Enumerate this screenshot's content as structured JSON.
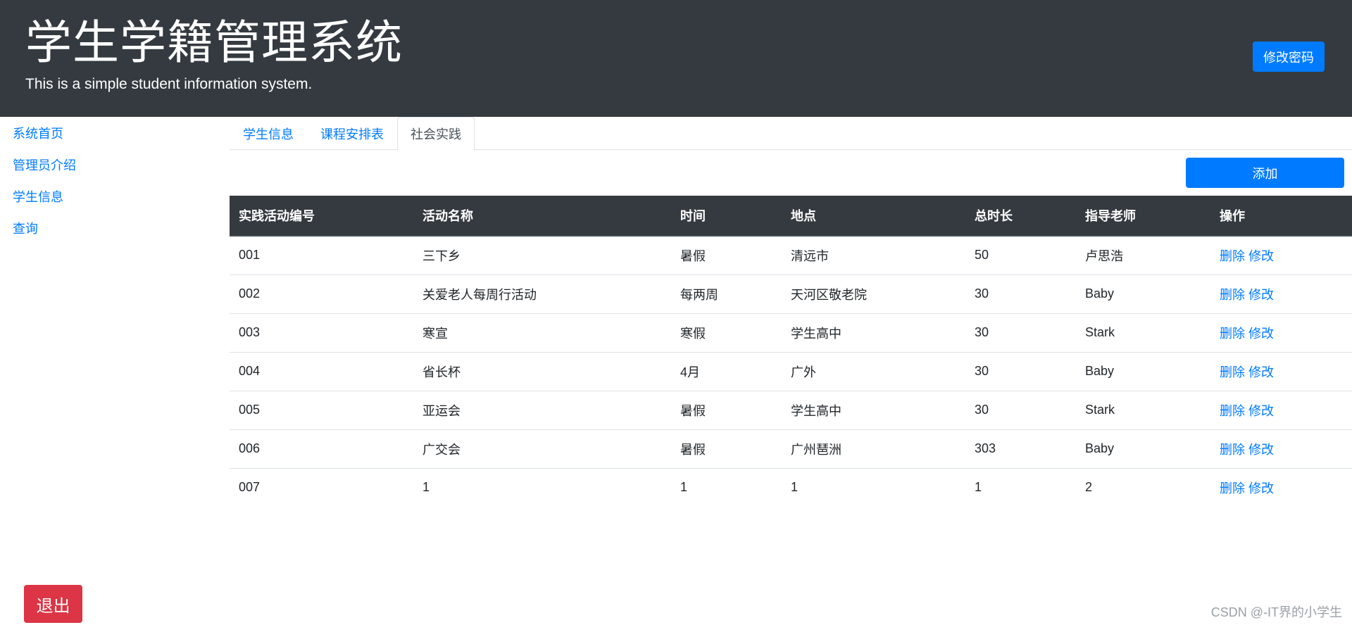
{
  "header": {
    "title": "学生学籍管理系统",
    "subtitle": "This is a simple student information system.",
    "change_password_label": "修改密码"
  },
  "sidebar": {
    "items": [
      {
        "label": "系统首页"
      },
      {
        "label": "管理员介绍"
      },
      {
        "label": "学生信息"
      },
      {
        "label": "查询"
      }
    ]
  },
  "tabs": [
    {
      "label": "学生信息",
      "active": false
    },
    {
      "label": "课程安排表",
      "active": false
    },
    {
      "label": "社会实践",
      "active": true
    }
  ],
  "toolbar": {
    "add_label": "添加"
  },
  "table": {
    "columns": [
      "实践活动编号",
      "活动名称",
      "时间",
      "地点",
      "总时长",
      "指导老师",
      "操作"
    ],
    "rows": [
      [
        "001",
        "三下乡",
        "暑假",
        "清远市",
        "50",
        "卢思浩"
      ],
      [
        "002",
        "关爱老人每周行活动",
        "每两周",
        "天河区敬老院",
        "30",
        "Baby"
      ],
      [
        "003",
        "寒宣",
        "寒假",
        "学生高中",
        "30",
        "Stark"
      ],
      [
        "004",
        "省长杯",
        "4月",
        "广外",
        "30",
        "Baby"
      ],
      [
        "005",
        "亚运会",
        "暑假",
        "学生高中",
        "30",
        "Stark"
      ],
      [
        "006",
        "广交会",
        "暑假",
        "广州琶洲",
        "303",
        "Baby"
      ],
      [
        "007",
        "1",
        "1",
        "1",
        "1",
        "2"
      ]
    ],
    "actions": {
      "delete_label": "删除",
      "edit_label": "修改"
    }
  },
  "footer": {
    "logout_label": "退出",
    "watermark": "CSDN @-IT界的小学生"
  },
  "colors": {
    "header_bg": "#343a40",
    "primary": "#007bff",
    "danger": "#dc3545"
  }
}
